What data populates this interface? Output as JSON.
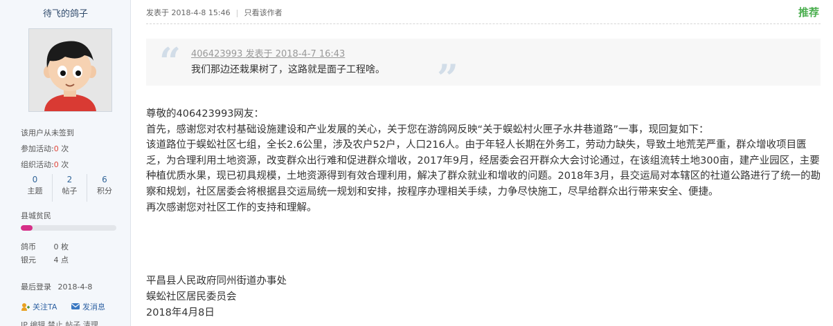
{
  "profile": {
    "username": "待飞的鸽子",
    "avatar_icon": "cartoon-boy-avatar",
    "sign_status": "该用户从未签到",
    "join_activity_label": "参加活动:",
    "join_activity_count": "0",
    "org_activity_label": "组织活动:",
    "org_activity_count": "0",
    "times_unit": "次",
    "stats": [
      {
        "value": "0",
        "label": "主题"
      },
      {
        "value": "2",
        "label": "帖子"
      },
      {
        "value": "6",
        "label": "积分"
      }
    ],
    "rank": "县城贫民",
    "rank_progress": 0.12,
    "currency": [
      {
        "label": "鸽币",
        "value": "0 枚"
      },
      {
        "label": "银元",
        "value": "4 点"
      }
    ],
    "last_login_label": "最后登录",
    "last_login": "2018-4-8",
    "follow_label": "关注TA",
    "message_label": "发消息",
    "footer_cut": "IP 编辑 禁止 帖子 清理"
  },
  "post": {
    "posted_at": "发表于 2018-4-8 15:46",
    "only_author": "只看该作者",
    "recommend": "推荐",
    "quote": {
      "header": "406423993 发表于 2018-4-7 16:43",
      "body": "我们那边还栽果树了，这路就是面子工程啥。"
    },
    "paragraphs": [
      "尊敬的406423993网友：",
      "首先，感谢您对农村基础设施建设和产业发展的关心，关于您在游鸽网反映“关于蜈蚣村火匣子水井巷道路”一事，现回复如下：",
      "该道路位于蜈蚣社区七组，全长2.6公里，涉及农户52户，人口216人。由于年轻人长期在外务工，劳动力缺失，导致土地荒芜严重，群众增收项目匮乏，为合理利用土地资源，改变群众出行难和促进群众增收，2017年9月，经居委会召开群众大会讨论通过，在该组流转土地300亩，建产业园区，主要种植优质水果，现已初具规模，土地资源得到有效合理利用，解决了群众就业和增收的问题。2018年3月，县交运局对本辖区的社道公路进行了统一的勘察和规划，社区居委会将根据县交运局统一规划和安排，按程序办理相关手续，力争尽快施工，尽早给群众出行带来安全、便捷。",
      "再次感谢您对社区工作的支持和理解。"
    ],
    "signature": [
      "平昌县人民政府同州街道办事处",
      "蜈蚣社区居民委员会",
      "2018年4月8日"
    ]
  }
}
